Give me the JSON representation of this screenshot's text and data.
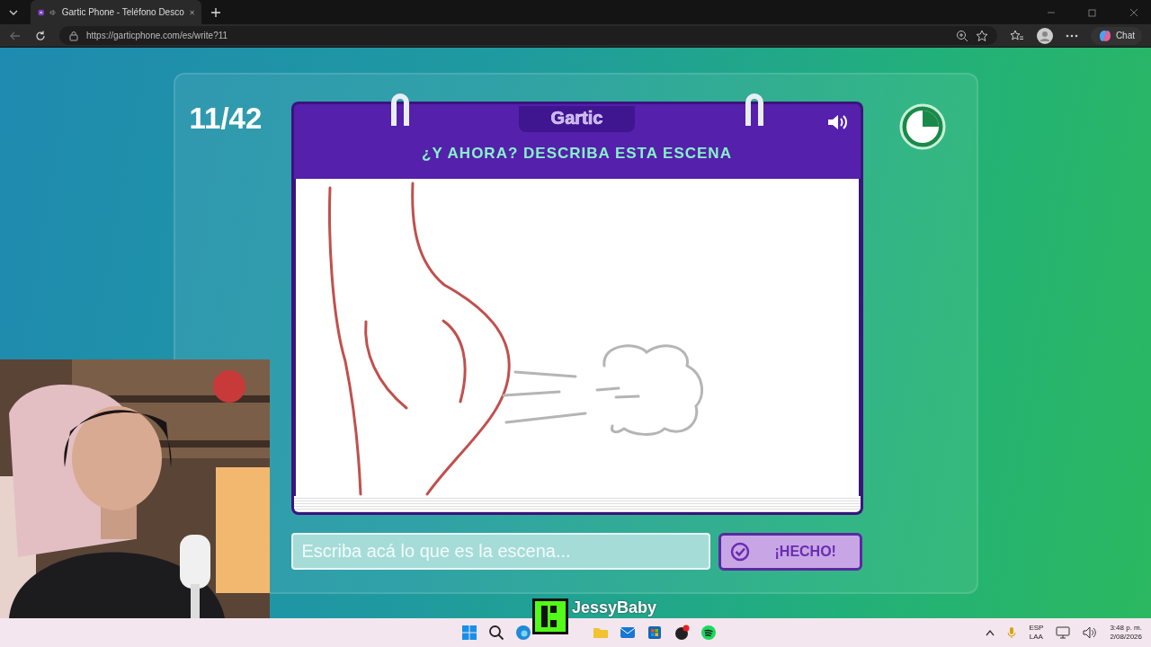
{
  "browser": {
    "tabs": [
      {
        "title": "Gartic Phone - Teléfono Desco",
        "selected": true
      }
    ],
    "url": "https://garticphone.com/es/write?11",
    "chat_label": "Chat"
  },
  "game": {
    "counter": "11/42",
    "logo": "Gartic",
    "prompt": "¿Y AHORA? DESCRIBA ESTA ESCENA",
    "answer": {
      "placeholder": "Escriba acá lo que es la escena..."
    },
    "done_button": "¡HECHO!"
  },
  "stream_overlay": {
    "name": "JessyBaby"
  },
  "taskbar": {
    "language": "ESP",
    "layout": "LAA",
    "time": "3:48 p. m.",
    "date": "2/08/2026"
  }
}
